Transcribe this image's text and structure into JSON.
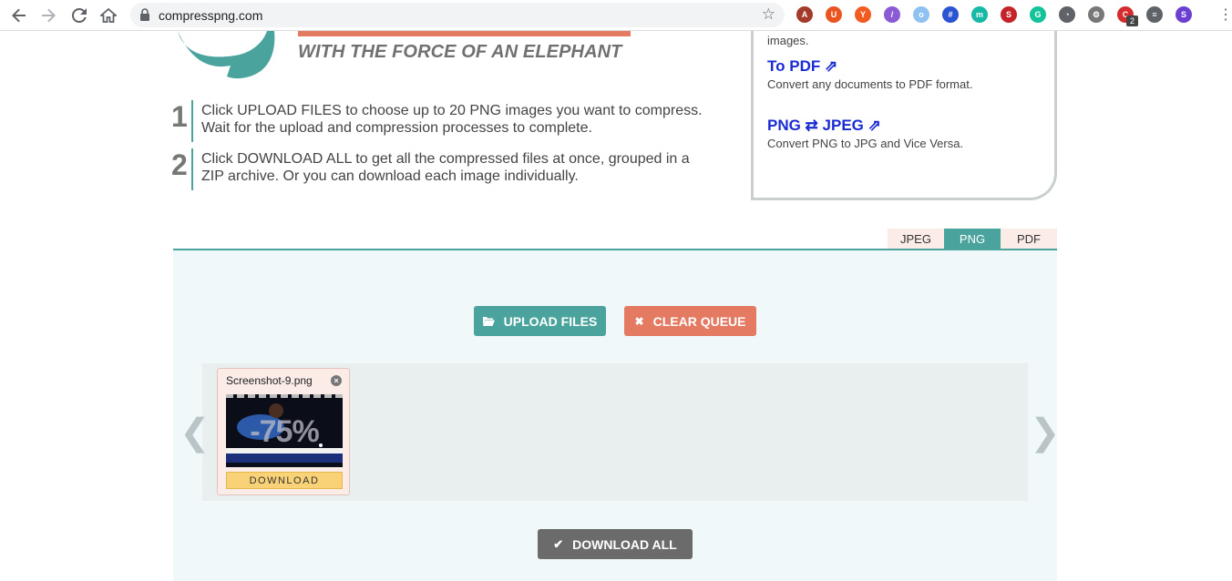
{
  "browser": {
    "url": "compresspng.com",
    "extensions": [
      {
        "name": "pdf-extension-icon",
        "color": "#a33a2a",
        "glyph": "A"
      },
      {
        "name": "ubuntu-extension-icon",
        "color": "#e95420",
        "glyph": "U"
      },
      {
        "name": "ya-extension-icon",
        "color": "#f25c22",
        "glyph": "Y"
      },
      {
        "name": "feather-extension-icon",
        "color": "#8b5bd6",
        "glyph": "/"
      },
      {
        "name": "circle-extension-icon",
        "color": "#8fc2f0",
        "glyph": "o"
      },
      {
        "name": "hash-extension-icon",
        "color": "#2a54d1",
        "glyph": "#"
      },
      {
        "name": "m-extension-icon",
        "color": "#17b8a6",
        "glyph": "m"
      },
      {
        "name": "seo-extension-icon",
        "color": "#c4232a",
        "glyph": "S"
      },
      {
        "name": "grammarly-extension-icon",
        "color": "#15c39a",
        "glyph": "G"
      },
      {
        "name": "speed-extension-icon",
        "color": "#5f6368",
        "glyph": "◔"
      },
      {
        "name": "gear-extension-icon",
        "color": "#777777",
        "glyph": "⚙"
      },
      {
        "name": "red-extension-icon",
        "color": "#d42c2c",
        "glyph": "C"
      },
      {
        "name": "playlist-extension-icon",
        "color": "#5f6368",
        "glyph": "≡"
      },
      {
        "name": "s-extension-icon",
        "color": "#6a3fd1",
        "glyph": "S"
      }
    ],
    "badge": "2"
  },
  "hero": {
    "tagline": "WITH THE FORCE OF AN ELEPHANT"
  },
  "steps": [
    {
      "num": "1",
      "text": "Click UPLOAD FILES to choose up to 20 PNG images you want to compress. Wait for the upload and compression processes to complete."
    },
    {
      "num": "2",
      "text": "Click DOWNLOAD ALL to get all the compressed files at once, grouped in a ZIP archive. Or you can download each image individually."
    }
  ],
  "sidebar": {
    "top_text": "images.",
    "link1": "To PDF ⇗",
    "desc1": "Convert any documents to PDF format.",
    "link2": "PNG ⇄ JPEG ⇗",
    "desc2": "Convert PNG to JPG and Vice Versa."
  },
  "tabs": [
    {
      "label": "JPEG",
      "active": false
    },
    {
      "label": "PNG",
      "active": true
    },
    {
      "label": "PDF",
      "active": false
    }
  ],
  "actions": {
    "upload": "UPLOAD FILES",
    "clear": "CLEAR QUEUE",
    "download_all": "DOWNLOAD ALL"
  },
  "queue": {
    "file": {
      "name": "Screenshot-9.png",
      "savings": "-75%",
      "download": "DOWNLOAD"
    }
  },
  "colors": {
    "teal": "#4aa39d",
    "coral": "#e57a63",
    "gray_button": "#6b6b6b",
    "link_blue": "#1a2bd3"
  }
}
